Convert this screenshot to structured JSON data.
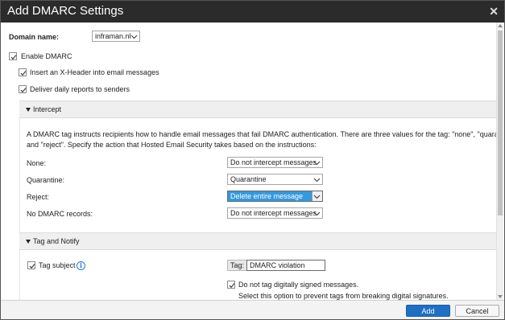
{
  "dialog": {
    "title": "Add DMARC Settings",
    "close_glyph": "✕"
  },
  "domain": {
    "label": "Domain name:",
    "value": "inframan.nl"
  },
  "options": {
    "enable_dmarc": {
      "label": "Enable DMARC",
      "checked": true
    },
    "insert_header": {
      "label": "Insert an X-Header into email messages",
      "checked": true
    },
    "daily_reports": {
      "label": "Deliver daily reports to senders",
      "checked": true
    }
  },
  "intercept": {
    "header": "Intercept",
    "description_line1": "A DMARC tag instructs recipients how to handle email messages that fail DMARC authentication. There are three values for the tag: \"none\", \"quarantine\",",
    "description_line2": "and \"reject\". Specify the action that Hosted Email Security takes based on the instructions:",
    "rows": [
      {
        "label": "None:",
        "value": "Do not intercept messages"
      },
      {
        "label": "Quarantine:",
        "value": "Quarantine"
      },
      {
        "label": "Reject:",
        "value": "Delete entire message"
      },
      {
        "label": "No DMARC records:",
        "value": "Do not intercept messages"
      }
    ]
  },
  "tag_notify": {
    "header": "Tag and Notify",
    "tag_subject": {
      "label": "Tag subject",
      "checked": true
    },
    "tag_label": "Tag:",
    "tag_value": "DMARC violation",
    "no_tag_signed": {
      "label": "Do not tag digitally signed messages.",
      "checked": true
    },
    "hint": "Select this option to prevent tags from breaking digital signatures."
  },
  "footer": {
    "add_label": "Add",
    "cancel_label": "Cancel"
  },
  "colors": {
    "title_bar": "#2b2b2b",
    "primary_button": "#1f6fc5",
    "selected_dropdown": "#3399e0",
    "info_icon": "#1e7bd8"
  }
}
